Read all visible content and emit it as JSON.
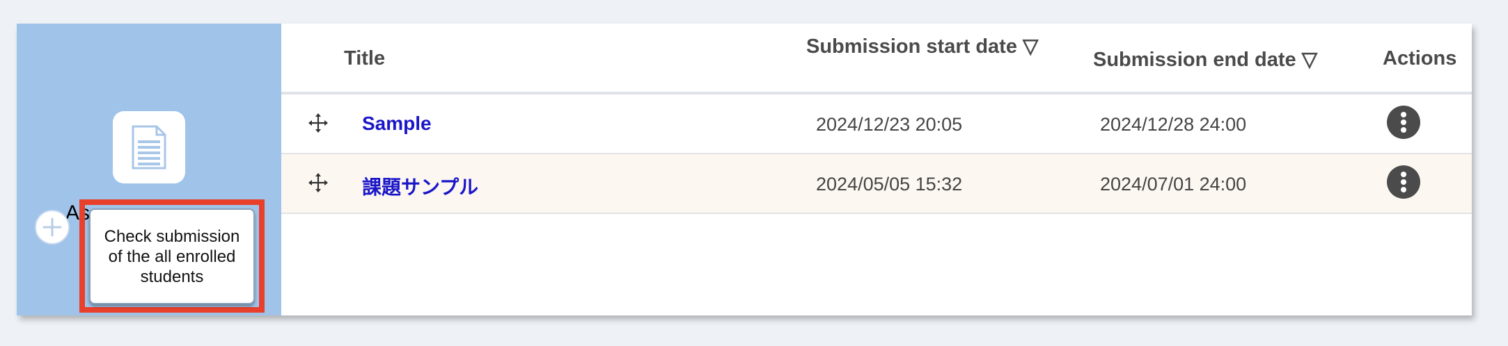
{
  "sidebar": {
    "label": "As",
    "tooltip": "Check submission of the all enrolled students",
    "icons": {
      "document": "document-icon",
      "add": "plus-icon"
    }
  },
  "table": {
    "headers": {
      "title": "Title",
      "start": "Submission start date ▽",
      "end": "Submission end date ▽",
      "actions": "Actions"
    },
    "rows": [
      {
        "title": "Sample",
        "start": "2024/12/23 20:05",
        "end": "2024/12/28 24:00"
      },
      {
        "title": "課題サンプル",
        "start": "2024/05/05 15:32",
        "end": "2024/07/01 24:00"
      }
    ]
  },
  "colors": {
    "sidebar_bg": "#a0c3ea",
    "link": "#1a16c8",
    "highlight": "#e8402a",
    "alt_row": "#fcf7f1"
  }
}
